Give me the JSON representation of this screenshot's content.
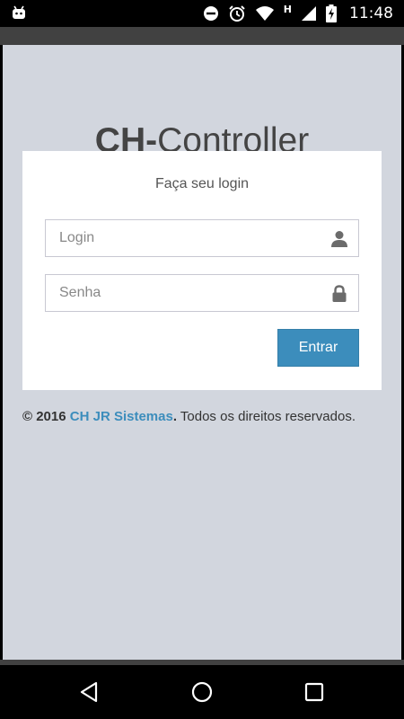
{
  "status_bar": {
    "time": "11:48",
    "network_letter": "H",
    "icons": [
      "android-debug-icon",
      "do-not-disturb-icon",
      "alarm-icon",
      "wifi-icon",
      "signal-icon",
      "battery-charging-icon"
    ]
  },
  "app": {
    "logo_bold": "CH-",
    "logo_regular": "Controller"
  },
  "login_card": {
    "title": "Faça seu login",
    "login_placeholder": "Login",
    "password_placeholder": "Senha",
    "submit_label": "Entrar"
  },
  "footer": {
    "copyright": "© 2016",
    "company": "CH JR Sistemas",
    "period": ".",
    "rights": "Todos os direitos reservados."
  },
  "colors": {
    "background": "#d2d6de",
    "accent": "#3c8dbc",
    "card": "#ffffff"
  },
  "nav_bar": {
    "icons": [
      "back-icon",
      "home-icon",
      "recent-apps-icon"
    ]
  }
}
